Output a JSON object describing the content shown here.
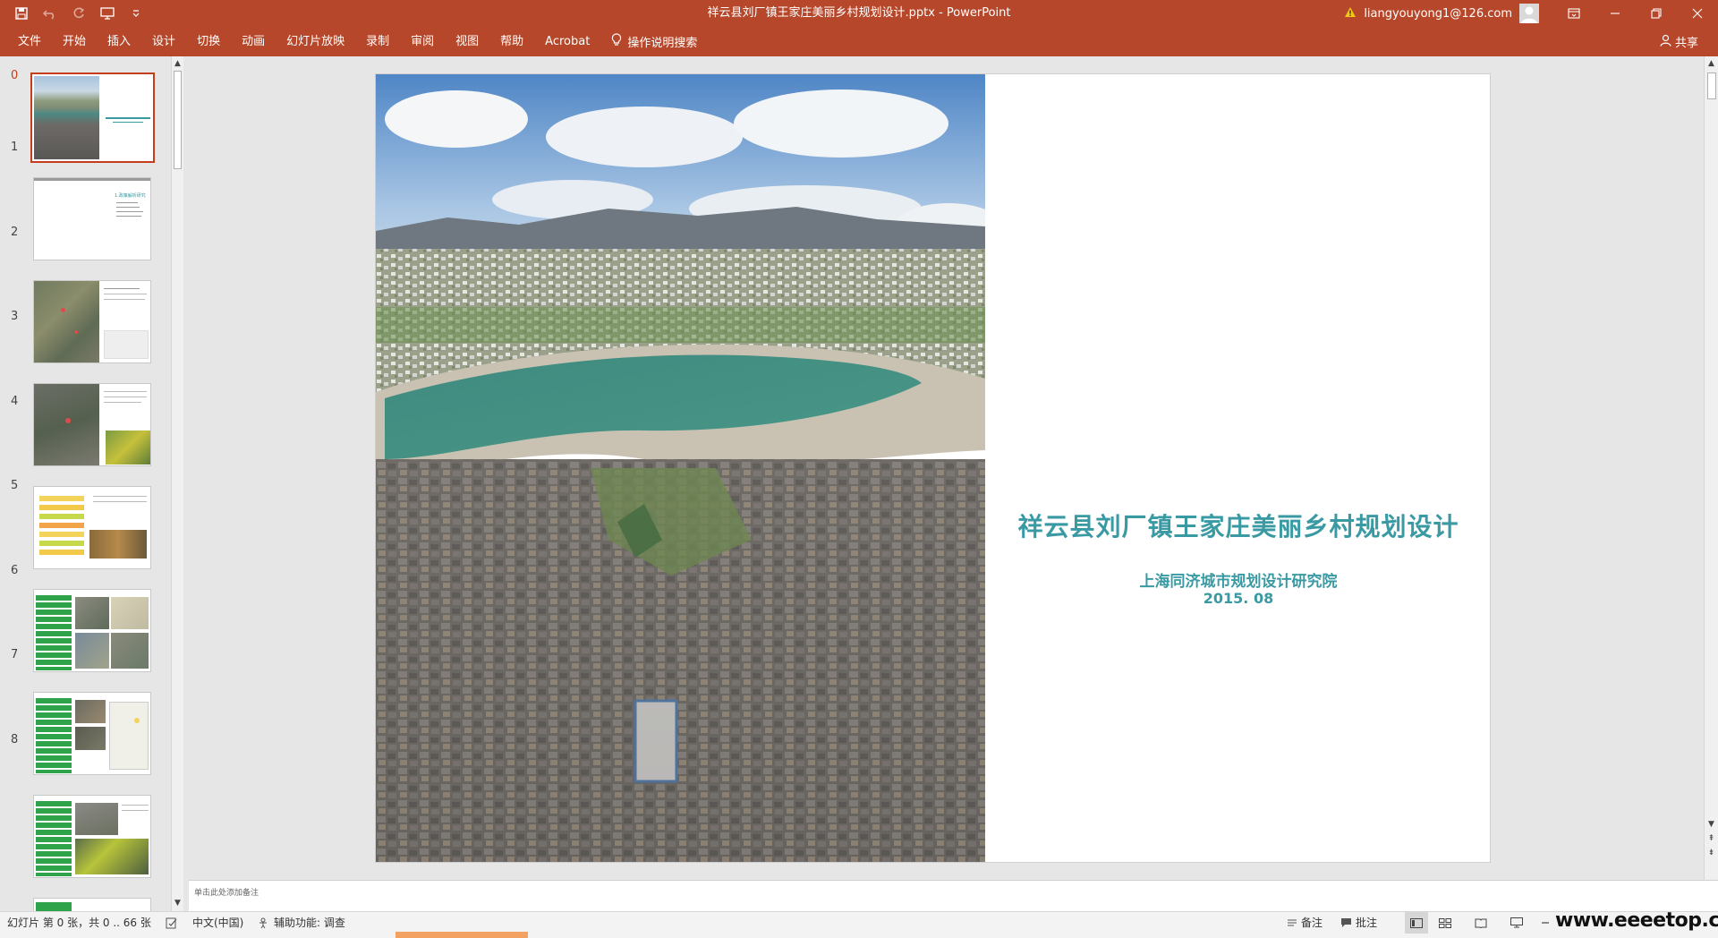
{
  "window": {
    "title": "祥云县刘厂镇王家庄美丽乡村规划设计.pptx  -  PowerPoint",
    "account": "liangyouyong1@126.com"
  },
  "ribbon": {
    "tabs": [
      "文件",
      "开始",
      "插入",
      "设计",
      "切换",
      "动画",
      "幻灯片放映",
      "录制",
      "审阅",
      "视图",
      "帮助",
      "Acrobat"
    ],
    "tell_me": "操作说明搜索",
    "share": "共享"
  },
  "thumbnails": {
    "numbers": [
      "0",
      "1",
      "2",
      "3",
      "4",
      "5",
      "6",
      "7",
      "8"
    ],
    "slide1_heading": "1.政策解析研究"
  },
  "slide": {
    "title": "祥云县刘厂镇王家庄美丽乡村规划设计",
    "organization": "上海同济城市规划设计研究院",
    "date": "2015. 08"
  },
  "notes": {
    "placeholder": "单击此处添加备注"
  },
  "status": {
    "slide_info": "幻灯片 第 0 张，共 0 .. 66 张",
    "language": "中文(中国)",
    "accessibility": "辅助功能: 调查",
    "notes_button": "备注",
    "comments_button": "批注"
  },
  "watermark": "www.eeeetop.com",
  "colors": {
    "accent": "#b7472a",
    "title_teal": "#3a9aa3",
    "selected_border": "#c43e1c"
  }
}
